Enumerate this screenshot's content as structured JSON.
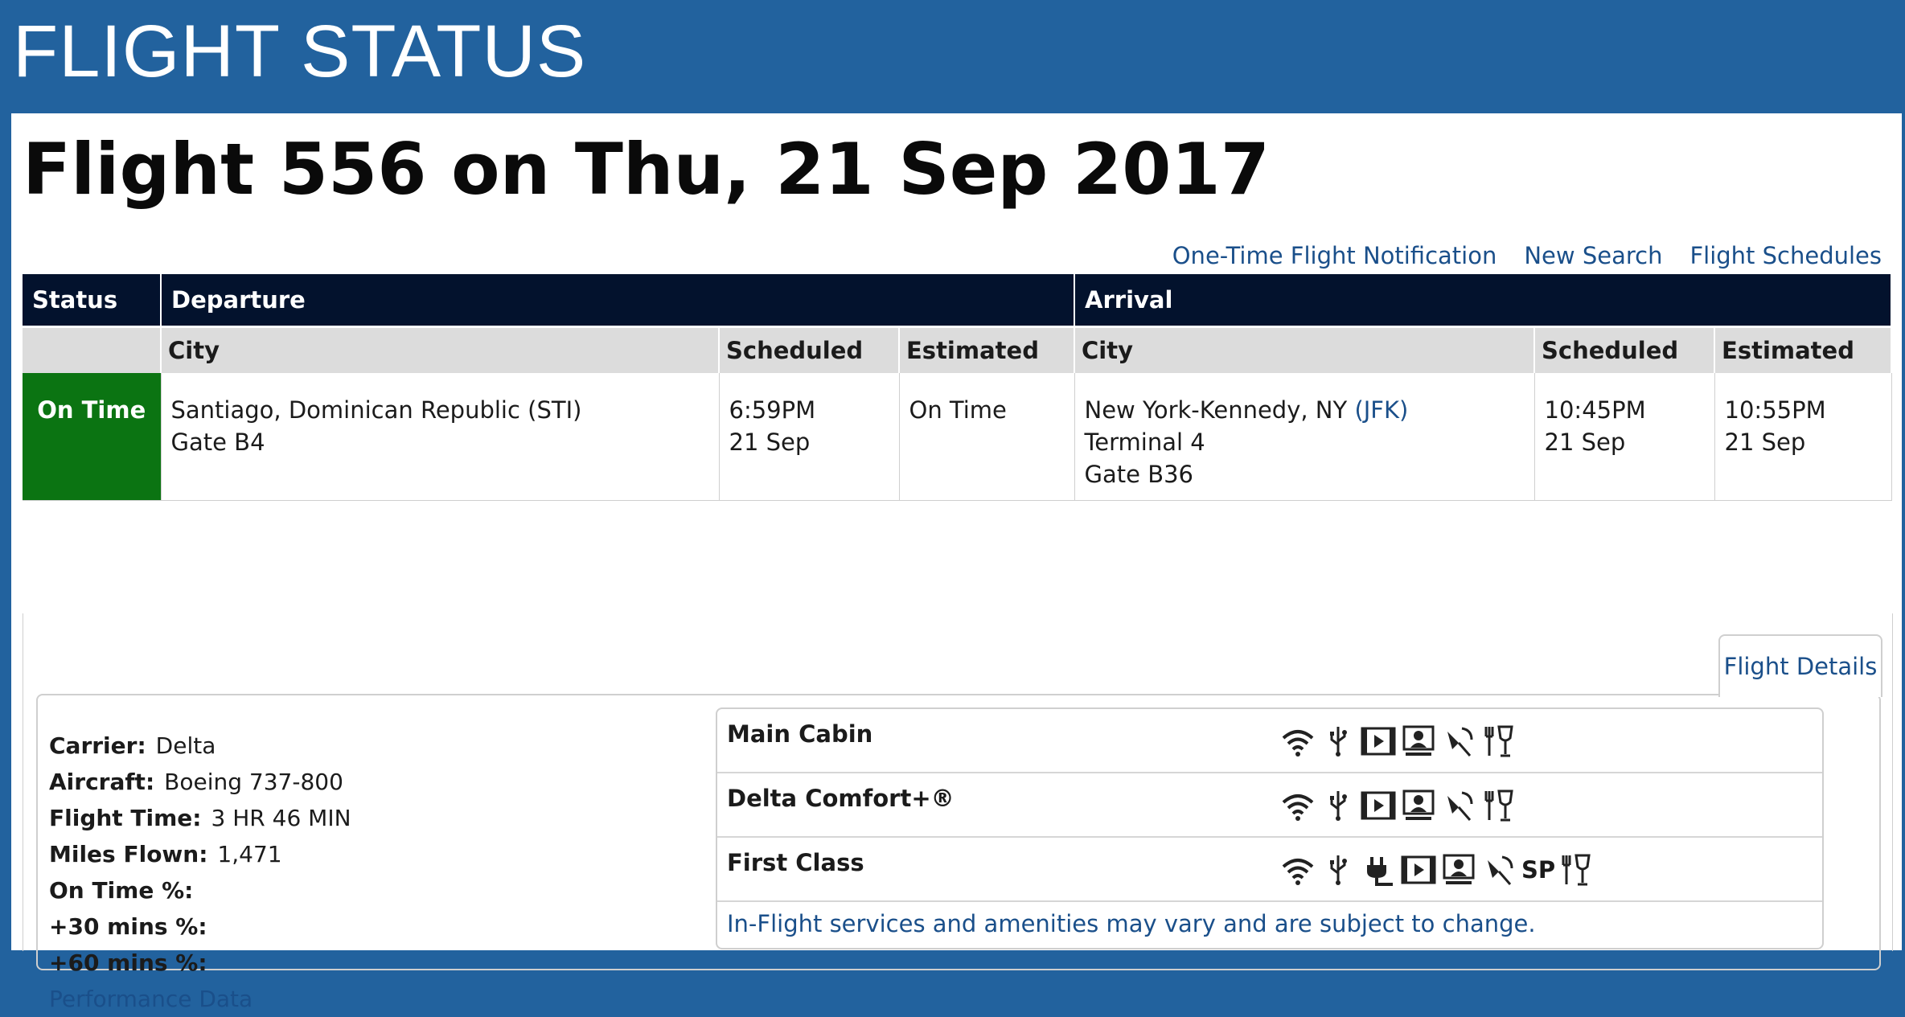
{
  "header": {
    "title": "FLIGHT STATUS"
  },
  "page": {
    "title": "Flight 556 on Thu, 21 Sep 2017"
  },
  "links": {
    "notification": "One-Time Flight Notification",
    "new_search": "New Search",
    "schedules": "Flight Schedules"
  },
  "table": {
    "group_headers": {
      "status": "Status",
      "departure": "Departure",
      "arrival": "Arrival"
    },
    "sub_headers": {
      "city": "City",
      "scheduled": "Scheduled",
      "estimated": "Estimated"
    },
    "row": {
      "status": "On Time",
      "dep_city": "Santiago, Dominican Republic (STI)",
      "dep_gate": "Gate B4",
      "dep_sched_time": "6:59PM",
      "dep_sched_date": "21 Sep",
      "dep_est": "On Time",
      "arr_city": "New York-Kennedy, NY",
      "arr_code": "(JFK)",
      "arr_terminal": "Terminal 4",
      "arr_gate": "Gate B36",
      "arr_sched_time": "10:45PM",
      "arr_sched_date": "21 Sep",
      "arr_est_time": "10:55PM",
      "arr_est_date": "21 Sep"
    }
  },
  "details_tab": "Flight Details",
  "info": {
    "carrier_label": "Carrier:",
    "carrier": "Delta",
    "aircraft_label": "Aircraft:",
    "aircraft": "Boeing 737-800",
    "flight_time_label": "Flight Time:",
    "flight_time": "3 HR 46 MIN",
    "miles_label": "Miles Flown:",
    "miles": "1,471",
    "ontime_label": "On Time %:",
    "plus30_label": "+30 mins %:",
    "plus60_label": "+60 mins %:",
    "performance_link": "Performance Data"
  },
  "cabins": [
    {
      "name": "Main Cabin",
      "icons": [
        "wifi-icon",
        "usb-icon",
        "video-icon",
        "personal-device-icon",
        "satellite-icon",
        "dining-icon"
      ]
    },
    {
      "name": "Delta Comfort+®",
      "icons": [
        "wifi-icon",
        "usb-icon",
        "video-icon",
        "personal-device-icon",
        "satellite-icon",
        "dining-icon"
      ]
    },
    {
      "name": "First Class",
      "icons": [
        "wifi-icon",
        "usb-icon",
        "power-icon",
        "video-icon",
        "personal-device-icon",
        "satellite-icon",
        "sp-icon",
        "dining-icon"
      ],
      "sp_text": "SP"
    }
  ],
  "cabin_note": "In-Flight services and amenities may vary and are subject to change.",
  "colors": {
    "brand": "#22629e",
    "header_dark": "#03122d",
    "on_time": "#0b7412",
    "link": "#1a4f8a"
  }
}
